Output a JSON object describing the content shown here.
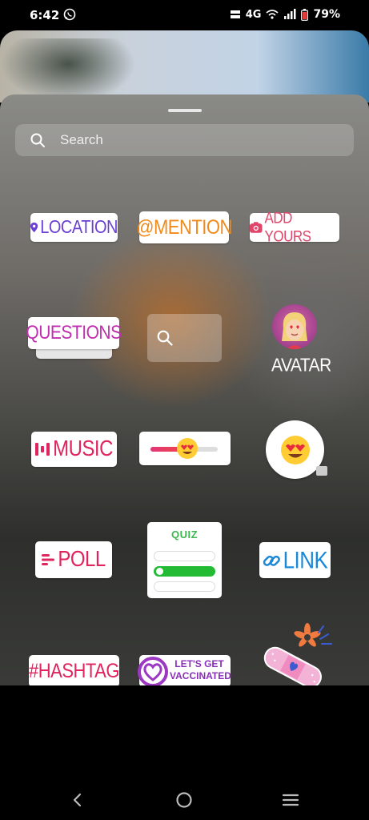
{
  "status_bar": {
    "time": "6:42",
    "network": "4G",
    "battery": "79%"
  },
  "search": {
    "placeholder": "Search"
  },
  "stickers": {
    "location": "LOCATION",
    "mention": "@MENTION",
    "add_yours": "ADD YOURS",
    "questions": "QUESTIONS",
    "avatar": "AVATAR",
    "music": "MUSIC",
    "poll": "POLL",
    "quiz": "QUIZ",
    "link": "LINK",
    "hashtag": "#HASHTAG",
    "vaccinated_line1": "LET'S GET",
    "vaccinated_line2": "VACCINATED"
  },
  "icons": [
    "whatsapp-icon",
    "wifi-icon",
    "signal-icon",
    "battery-icon",
    "search-icon",
    "location-pin-icon",
    "camera-icon",
    "music-bars-icon",
    "poll-lines-icon",
    "link-icon",
    "heart-icon",
    "heart-eyes-emoji-icon",
    "back-icon",
    "home-icon",
    "recents-icon"
  ],
  "colors": {
    "location": "#6a3fd3",
    "mention": "#f08a1a",
    "add_yours": "#e0456a",
    "questions": "#c02fb0",
    "music": "#e0245e",
    "poll": "#e0245e",
    "quiz": "#3cba4c",
    "link": "#1a88d8",
    "hashtag": "#e0245e",
    "vaccinated": "#8a2fb9"
  },
  "emoji_slider_level": 0.55
}
